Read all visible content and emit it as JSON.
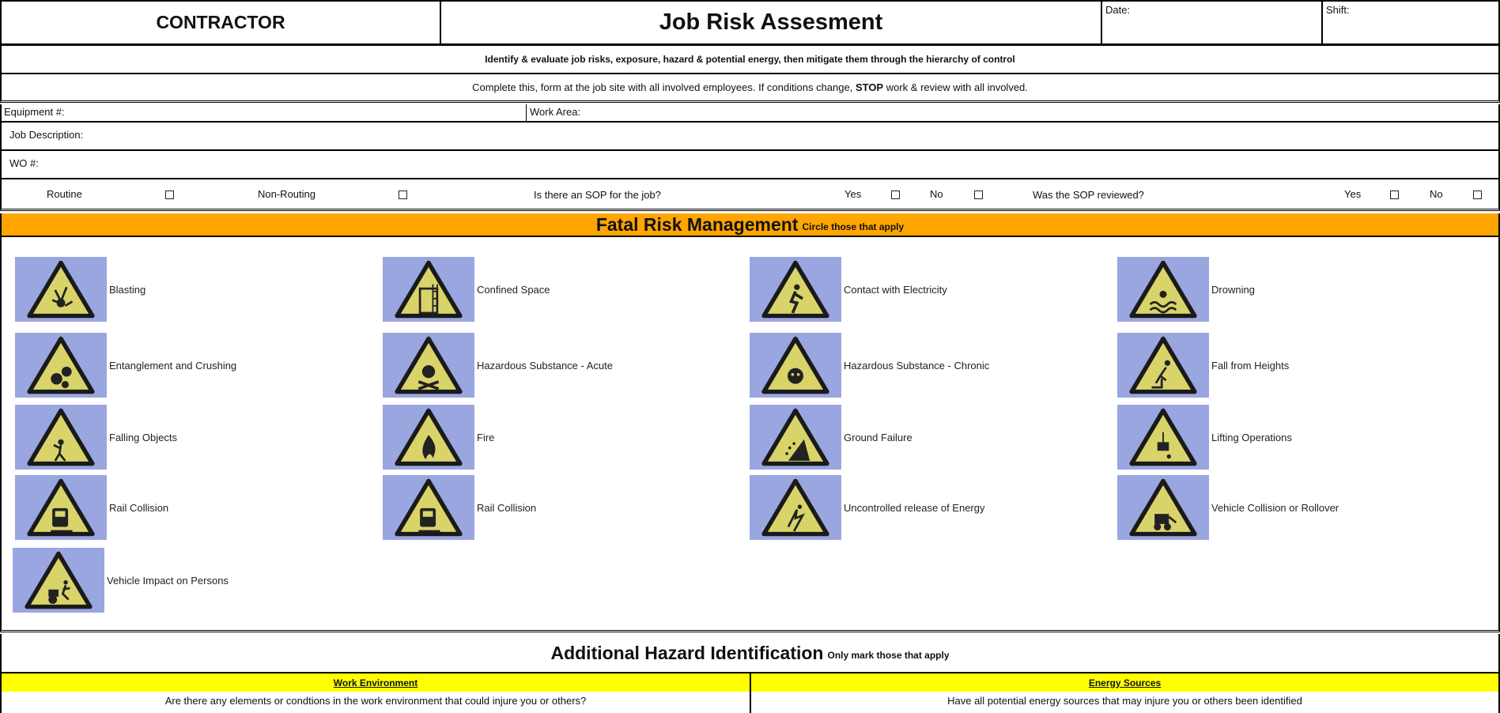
{
  "header": {
    "contractor": "CONTRACTOR",
    "title": "Job Risk Assesment",
    "date_label": "Date:",
    "shift_label": "Shift:"
  },
  "instructions": {
    "line1": "Identify & evaluate job risks, exposure, hazard & potential energy, then mitigate them through the hierarchy of control",
    "line2_pre": "Complete this, form at the job site with all involved employees. If conditions change, ",
    "line2_bold": "STOP",
    "line2_post": " work & review with all involved."
  },
  "fields": {
    "equipment": "Equipment #:",
    "work_area": "Work Area:",
    "job_description": "Job Description:",
    "wo": "WO #:"
  },
  "checks": {
    "routine": "Routine",
    "non_routine": "Non-Routing",
    "sop_question": "Is there an SOP for the job?",
    "yes": "Yes",
    "no": "No",
    "sop_reviewed": "Was the SOP reviewed?"
  },
  "fatal": {
    "title": "Fatal Risk Management",
    "subtitle": "Circle those that apply",
    "band_color": "#ffa500",
    "icon_bg": "#9aa6e0",
    "sign_color": "#d8d46a",
    "hazards": [
      {
        "label": "Blasting",
        "icon": "explosion-icon"
      },
      {
        "label": "Confined Space",
        "icon": "confined-space-icon"
      },
      {
        "label": "Contact with Electricity",
        "icon": "electrocution-icon"
      },
      {
        "label": "Drowning",
        "icon": "drowning-icon"
      },
      {
        "label": "Entanglement and Crushing",
        "icon": "gears-icon"
      },
      {
        "label": "Hazardous Substance - Acute",
        "icon": "skull-crossbones-icon"
      },
      {
        "label": "Hazardous Substance - Chronic",
        "icon": "respirator-icon"
      },
      {
        "label": "Fall from Heights",
        "icon": "falling-person-icon"
      },
      {
        "label": "Falling Objects",
        "icon": "falling-objects-icon"
      },
      {
        "label": "Fire",
        "icon": "flame-icon"
      },
      {
        "label": "Ground Failure",
        "icon": "landslide-icon"
      },
      {
        "label": "Lifting Operations",
        "icon": "crane-load-icon"
      },
      {
        "label": "Rail Collision",
        "icon": "train-icon"
      },
      {
        "label": "Rail Collision",
        "icon": "train-icon"
      },
      {
        "label": "Uncontrolled release of Energy",
        "icon": "energy-release-icon"
      },
      {
        "label": "Vehicle Collision or Rollover",
        "icon": "loader-vehicle-icon"
      },
      {
        "label": "Vehicle Impact on Persons",
        "icon": "vehicle-person-icon"
      }
    ]
  },
  "additional": {
    "title": "Additional Hazard Identification",
    "subtitle": "Only mark those that apply",
    "band_color": "#ffff00",
    "work_env_title": "Work Environment",
    "work_env_question": "Are there any elements or condtions in the work environment that could injure you or others?",
    "energy_title": "Energy Sources",
    "energy_question": "Have all potential energy sources that may injure you or others been identified"
  }
}
